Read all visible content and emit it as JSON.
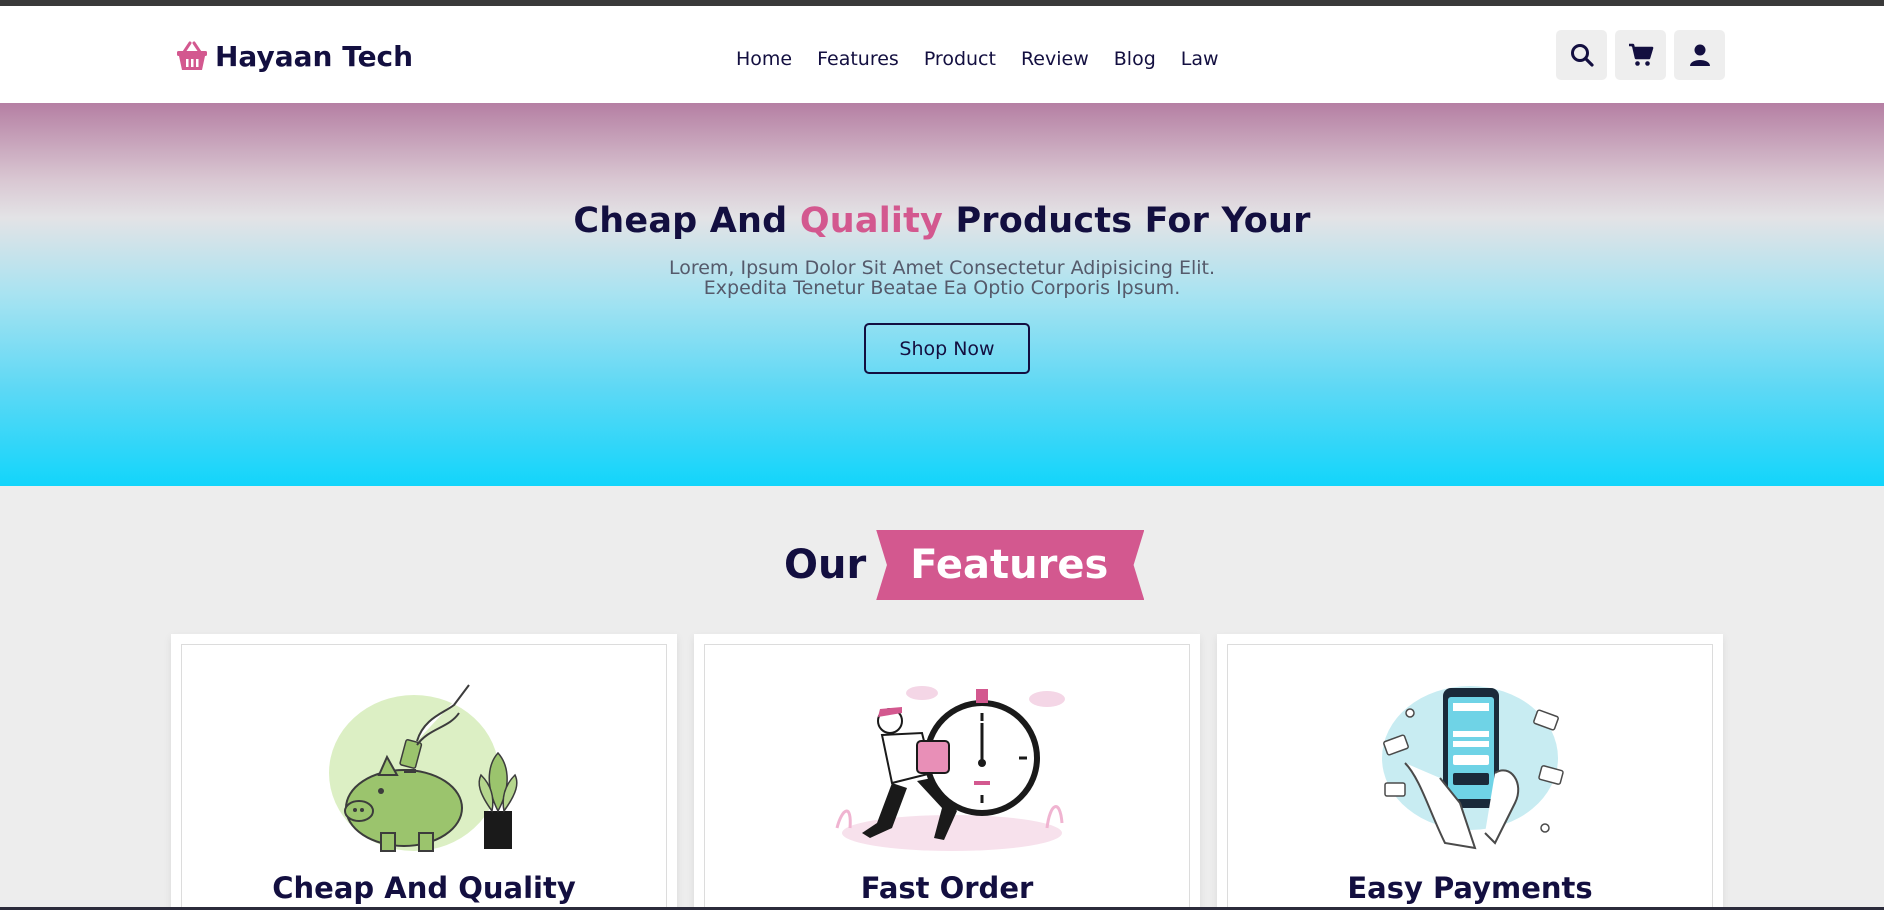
{
  "header": {
    "logo_text": "Hayaan Tech",
    "logo_icon": "basket-icon",
    "nav": [
      "Home",
      "Features",
      "Product",
      "Review",
      "Blog",
      "Law"
    ],
    "icons": [
      "search-icon",
      "cart-icon",
      "user-icon"
    ]
  },
  "hero": {
    "title_pre": "Cheap And ",
    "title_accent": "Quality",
    "title_post": " Products For Your",
    "description": "Lorem, Ipsum Dolor Sit Amet Consectetur Adipisicing Elit. Expedita Tenetur Beatae Ea Optio Corporis Ipsum.",
    "button_label": "Shop Now"
  },
  "features": {
    "heading_plain": "Our",
    "heading_ribbon": "Features",
    "cards": [
      {
        "title": "Cheap And Quality",
        "image": "piggy-bank-illustration"
      },
      {
        "title": "Fast Order",
        "image": "delivery-clock-illustration"
      },
      {
        "title": "Easy Payments",
        "image": "phone-payment-illustration"
      }
    ]
  },
  "colors": {
    "primary": "#130f40",
    "accent": "#d3588f",
    "hero_top": "#b57fa3",
    "hero_bottom": "#12d5fb",
    "page_bg": "#ededed"
  }
}
